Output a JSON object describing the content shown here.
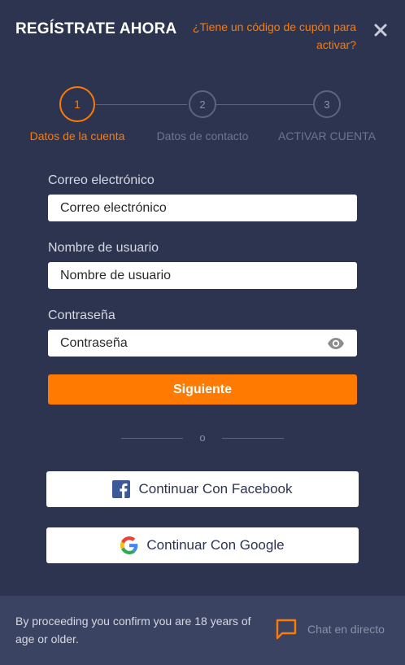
{
  "header": {
    "title": "REGÍSTRATE AHORA",
    "coupon_link": "¿Tiene un código de cupón para activar?",
    "close_icon": "close-icon"
  },
  "stepper": {
    "steps": [
      {
        "number": "1",
        "label": "Datos de la cuenta",
        "active": true
      },
      {
        "number": "2",
        "label": "Datos de contacto",
        "active": false
      },
      {
        "number": "3",
        "label": "ACTIVAR CUENTA",
        "active": false
      }
    ]
  },
  "form": {
    "email": {
      "label": "Correo electrónico",
      "placeholder": "Correo electrónico"
    },
    "username": {
      "label": "Nombre de usuario",
      "placeholder": "Nombre de usuario"
    },
    "password": {
      "label": "Contraseña",
      "placeholder": "Contraseña",
      "toggle_icon": "eye-icon"
    },
    "next_button": "Siguiente"
  },
  "divider": {
    "text": "o"
  },
  "social": {
    "facebook": {
      "label": "Continuar Con Facebook",
      "icon": "facebook-icon"
    },
    "google": {
      "label": "Continuar Con Google",
      "icon": "google-icon"
    }
  },
  "footer": {
    "disclaimer": "By proceeding you confirm you are 18 years of age or older.",
    "chat_label": "Chat en directo",
    "chat_icon": "chat-icon"
  },
  "colors": {
    "background": "#2c3450",
    "footer_background": "#3a4362",
    "accent": "#ff7a00",
    "muted": "#6d7590"
  }
}
